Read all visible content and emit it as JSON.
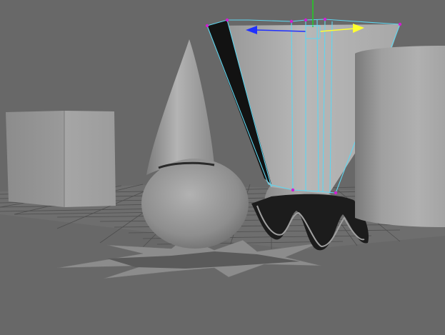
{
  "viewport": {
    "kind": "3d-perspective-viewport",
    "background_color": "#686868",
    "grid_color": "#4a4a4a",
    "selection_wire_color": "#5fd6f0",
    "vertex_color": "#d020d0"
  },
  "manipulator": {
    "tool": "move",
    "axis_x_color": "#ffff30",
    "axis_z_color": "#2030ff",
    "axis_y_color": "#20d020"
  },
  "objects": [
    {
      "name": "cube",
      "selected": false
    },
    {
      "name": "cone",
      "selected": false
    },
    {
      "name": "sphere",
      "selected": false
    },
    {
      "name": "half-sphere",
      "selected": false
    },
    {
      "name": "frustum-cone",
      "selected": true
    },
    {
      "name": "cylinder",
      "selected": false
    },
    {
      "name": "wavy-ring",
      "selected": false
    },
    {
      "name": "star-plane",
      "selected": false
    }
  ]
}
